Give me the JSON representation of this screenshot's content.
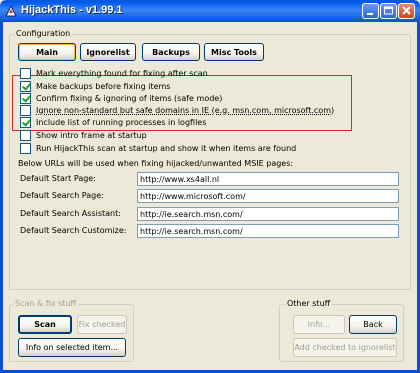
{
  "window": {
    "title": "HijackThis - v1.99.1"
  },
  "config": {
    "group_title": "Configuration",
    "tabs": [
      "Main",
      "Ignorelist",
      "Backups",
      "Misc Tools"
    ],
    "checkboxes": [
      {
        "label": "Mark everything found for fixing after scan",
        "checked": false
      },
      {
        "label": "Make backups before fixing items",
        "checked": true
      },
      {
        "label": "Confirm fixing & ignoring of items (safe mode)",
        "checked": true
      },
      {
        "label": "Ignore non-standard but safe domains in IE (e.g. msn.com, microsoft.com)",
        "checked": false
      },
      {
        "label": "Include list of running processes in logfiles",
        "checked": true
      },
      {
        "label": "Show intro frame at startup",
        "checked": false
      },
      {
        "label": "Run HijackThis scan at startup and show it when items are found",
        "checked": false
      }
    ],
    "urls_intro": "Below URLs will be used when fixing hijacked/unwanted MSIE pages:",
    "urls": [
      {
        "label": "Default Start Page:",
        "value": "http://www.xs4all.nl"
      },
      {
        "label": "Default Search Page:",
        "value": "http://www.microsoft.com/"
      },
      {
        "label": "Default Search Assistant:",
        "value": "http://ie.search.msn.com/"
      },
      {
        "label": "Default Search Customize:",
        "value": "http://ie.search.msn.com/"
      }
    ]
  },
  "scan_group": {
    "title": "Scan & fix stuff",
    "scan_label": "Scan",
    "fix_label": "Fix checked",
    "info_label": "Info on selected item..."
  },
  "other_group": {
    "title": "Other stuff",
    "info_label": "Info...",
    "back_label": "Back",
    "add_label": "Add checked to ignorelist"
  }
}
